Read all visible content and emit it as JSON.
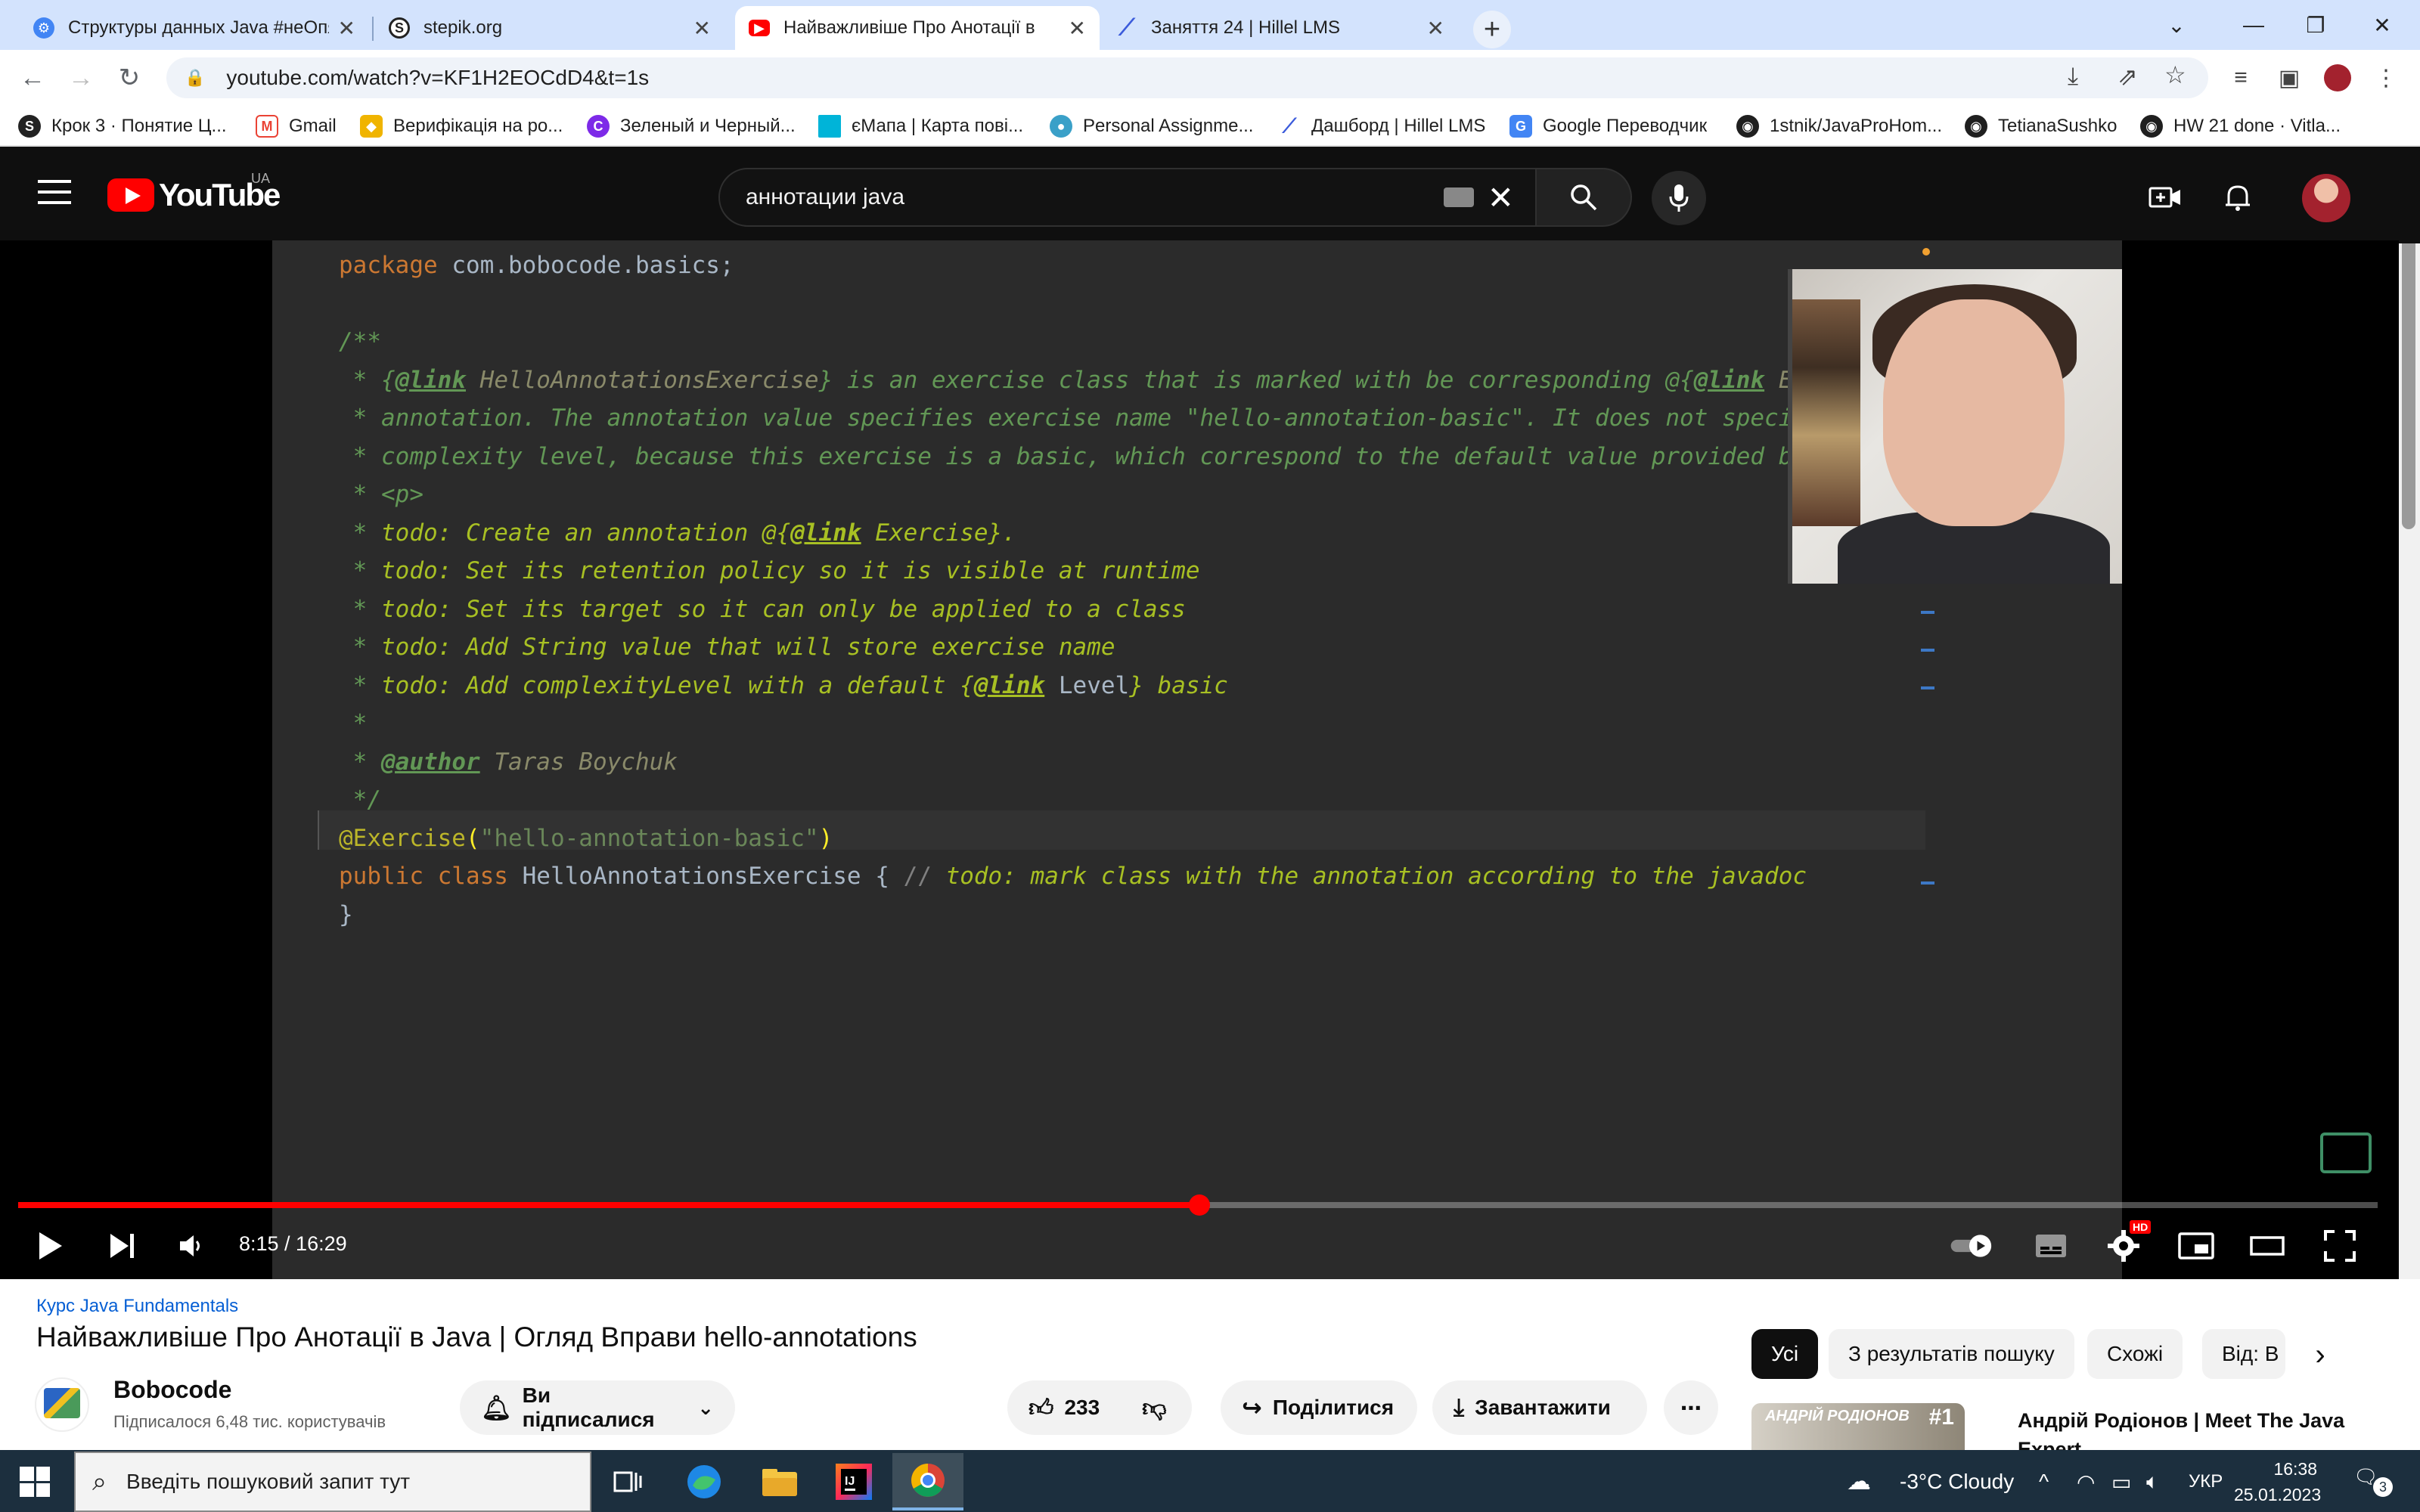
{
  "browser": {
    "tabs": [
      {
        "title": "Структуры данных Java #неОпя",
        "favicon": "course-icon",
        "color": "#4285f4"
      },
      {
        "title": "stepik.org",
        "favicon": "stepik-icon",
        "color": "#222222"
      },
      {
        "title": "Найважливіше Про Анотації в",
        "favicon": "youtube-icon",
        "color": "#ff0000"
      },
      {
        "title": "Заняття 24 | Hillel LMS",
        "favicon": "hillel-icon",
        "color": "#3b5bdb"
      }
    ],
    "active_tab_index": 2,
    "url": "youtube.com/watch?v=KF1H2EOCdD4&t=1s",
    "bookmarks": [
      {
        "label": "Крок 3 · Понятие Ц...",
        "icon": "stepik-icon"
      },
      {
        "label": "Gmail",
        "icon": "gmail-icon"
      },
      {
        "label": "Верифікація на ро...",
        "icon": "verify-icon"
      },
      {
        "label": "Зеленый и Черный...",
        "icon": "canva-icon"
      },
      {
        "label": "єМапа | Карта пові...",
        "icon": "map-icon"
      },
      {
        "label": "Personal Assignme...",
        "icon": "assign-icon"
      },
      {
        "label": "Дашборд | Hillel LMS",
        "icon": "hillel-icon"
      },
      {
        "label": "Google Переводчик",
        "icon": "translate-icon"
      },
      {
        "label": "1stnik/JavaProHom...",
        "icon": "github-icon"
      },
      {
        "label": "TetianaSushko",
        "icon": "github-icon"
      },
      {
        "label": "HW 21 done · Vitla...",
        "icon": "github-icon"
      }
    ]
  },
  "youtube": {
    "country_code": "UA",
    "logo_text": "YouTube",
    "search_query": "аннотации java",
    "player": {
      "current_time": "8:15",
      "duration": "16:29",
      "time_display": "8:15 / 16:29",
      "progress_fraction": 0.5005,
      "hd_badge": "HD"
    },
    "code_lines": [
      "package com.bobocode.basics;",
      "",
      "/**",
      " * {@link HelloAnnotationsExercise} is an exercise class that is marked with be corresponding @{@link Exe",
      " * annotation. The annotation value specifies exercise name \"hello-annotation-basic\". It does not specif",
      " * complexity level, because this exercise is a basic, which correspond to the default value provided by",
      " * <p>",
      " * todo: Create an annotation @{@link Exercise}.",
      " * todo: Set its retention policy so it is visible at runtime",
      " * todo: Set its target so it can only be applied to a class",
      " * todo: Add String value that will store exercise name",
      " * todo: Add complexityLevel with a default {@link Level} basic",
      " *",
      " * @author Taras Boychuk",
      " */",
      "@Exercise(\"hello-annotation-basic\")",
      "public class HelloAnnotationsExercise { // todo: mark class with the annotation according to the javadoc",
      "}"
    ],
    "video": {
      "playlist": "Курс Java Fundamentals",
      "title": "Найважливіше Про Анотації в Java | Огляд Вправи hello-annotations",
      "channel": "Bobocode",
      "subscribers": "Підписалося 6,48 тис. користувачів",
      "subscribe_label": "Ви підписалися",
      "likes": "233",
      "share_label": "Поділитися",
      "download_label": "Завантажити"
    },
    "chips": [
      "Усі",
      "З результатів пошуку",
      "Схожі",
      "Від: B"
    ],
    "related": {
      "thumb_text": "АНДРІЙ РОДІОНОВ",
      "thumb_rank": "#1",
      "title": "Андрій Родіонов | Meet The Java Expert"
    }
  },
  "taskbar": {
    "search_placeholder": "Введіть пошуковий запит тут",
    "weather": "-3°C  Cloudy",
    "language": "УКР",
    "time": "16:38",
    "date": "25.01.2023",
    "notification_count": "3"
  }
}
